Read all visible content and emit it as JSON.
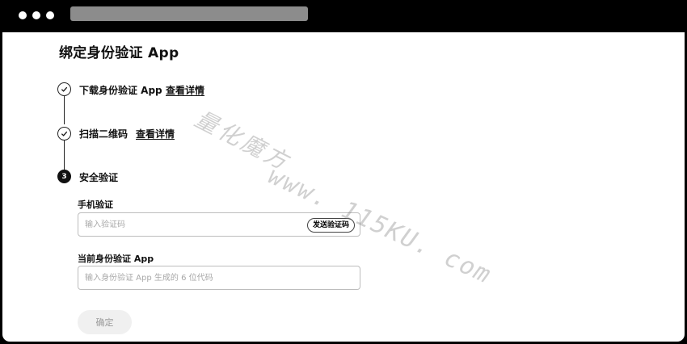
{
  "page": {
    "title": "绑定身份验证 App"
  },
  "steps": [
    {
      "label": "下载身份验证 App",
      "link": "查看详情",
      "status": "done"
    },
    {
      "label": "扫描二维码",
      "link": "查看详情",
      "status": "done"
    },
    {
      "number": "3",
      "label": "安全验证",
      "status": "active"
    }
  ],
  "form": {
    "phone": {
      "label": "手机验证",
      "placeholder": "输入验证码",
      "value": "",
      "send_button": "发送验证码"
    },
    "app_code": {
      "label": "当前身份验证 App",
      "placeholder": "输入身份验证 App 生成的 6 位代码",
      "value": ""
    },
    "confirm_button": "确定"
  },
  "watermark": {
    "line1": "量化魔方",
    "line2": "www. 115KU. com"
  },
  "colors": {
    "chrome": "#000000",
    "address_bar": "#8c8c8c",
    "text": "#111111",
    "placeholder": "#a8a8a8",
    "disabled_button_bg": "#f0f0f0",
    "disabled_button_text": "#9a9a9a"
  },
  "icons": {
    "step_done": "check-icon"
  }
}
